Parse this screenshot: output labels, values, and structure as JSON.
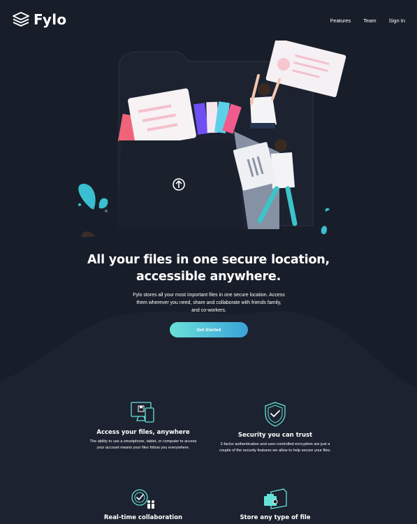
{
  "header": {
    "logo_text": "Fylo",
    "nav": [
      "Features",
      "Team",
      "Sign In"
    ]
  },
  "hero": {
    "title_line1": "All your files in one secure location,",
    "title_line2": "accessible anywhere.",
    "description": "Fylo stores all your most important files in one secure location. Access them wherever you need, share and collaborate with friends family, and co-workers.",
    "cta_label": "Get Started"
  },
  "features": [
    {
      "icon": "devices-icon",
      "title": "Access your files, anywhere",
      "text": "The ability to use a smartphone, tablet, or computer to access your account means your files follow you everywhere."
    },
    {
      "icon": "shield-check-icon",
      "title": "Security you can trust",
      "text": "2-factor authentication and user-controlled encryption are just a couple of the security features we allow to help secure your files."
    },
    {
      "icon": "collaboration-icon",
      "title": "Real-time collaboration",
      "text": ""
    },
    {
      "icon": "files-icon",
      "title": "Store any type of file",
      "text": ""
    }
  ],
  "colors": {
    "background": "#1c2230",
    "hero_background": "#181e29",
    "accent_cyan": "#65e2d9",
    "accent_blue": "#339ecc"
  }
}
